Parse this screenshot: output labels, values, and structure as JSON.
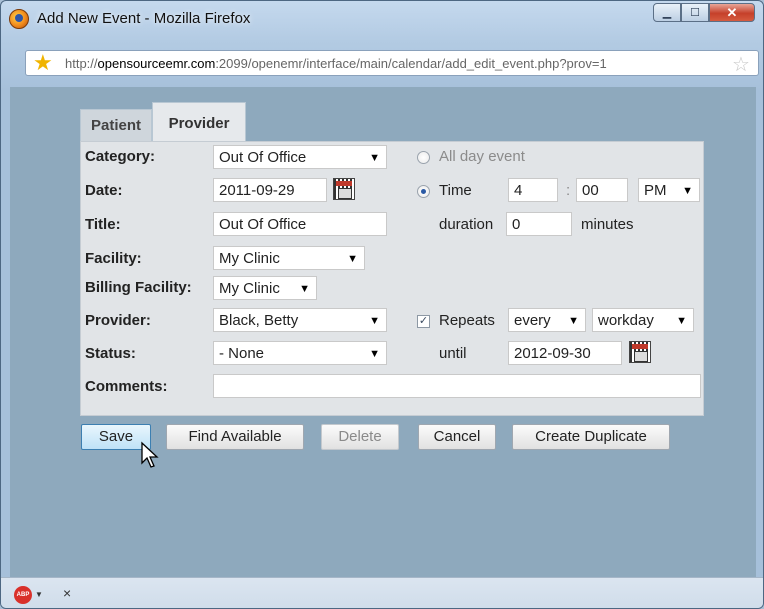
{
  "window": {
    "title": "Add New Event - Mozilla Firefox",
    "url_prefix": "http://",
    "url_domain": "opensourceemr.com",
    "url_rest": ":2099/openemr/interface/main/calendar/add_edit_event.php?prov=1"
  },
  "tabs": {
    "patient": "Patient",
    "provider": "Provider"
  },
  "form": {
    "category_label": "Category:",
    "category_value": "Out Of Office",
    "date_label": "Date:",
    "date_value": "2011-09-29",
    "title_label": "Title:",
    "title_value": "Out Of Office",
    "facility_label": "Facility:",
    "facility_value": "My Clinic",
    "billing_label": "Billing Facility:",
    "billing_value": "My Clinic",
    "provider_label": "Provider:",
    "provider_value": "Black, Betty",
    "status_label": "Status:",
    "status_value": "- None",
    "comments_label": "Comments:",
    "comments_value": "",
    "allday_label": "All day event",
    "time_label": "Time",
    "time_hour": "4",
    "time_sep": ":",
    "time_min": "00",
    "time_ampm": "PM",
    "duration_label": "duration",
    "duration_value": "0",
    "minutes_label": "minutes",
    "repeats_label": "Repeats",
    "repeats_every": "every",
    "repeats_unit": "workday",
    "until_label": "until",
    "until_value": "2012-09-30"
  },
  "buttons": {
    "save": "Save",
    "find": "Find Available",
    "delete": "Delete",
    "cancel": "Cancel",
    "duplicate": "Create Duplicate"
  },
  "statusbar": {
    "abp": "ABP",
    "close": "×"
  }
}
